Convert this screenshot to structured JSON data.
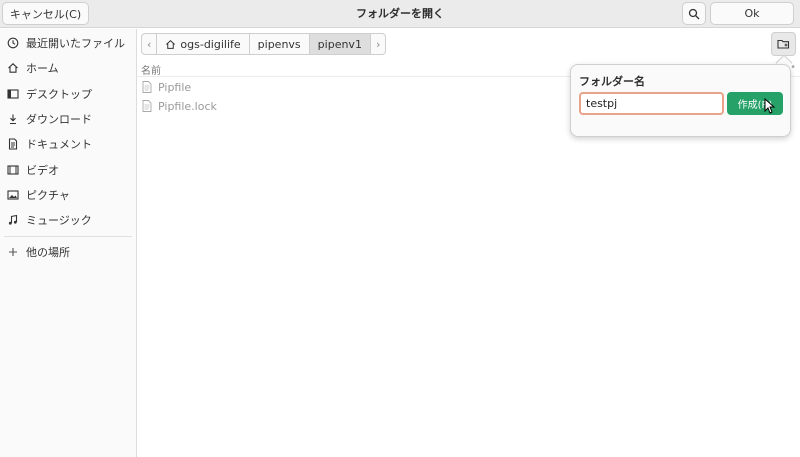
{
  "header": {
    "cancel_label": "キャンセル(C)",
    "title": "フォルダーを開く",
    "ok_label": "Ok"
  },
  "sidebar": {
    "items": [
      {
        "label": "最近開いたファイル",
        "icon": "clock-icon"
      },
      {
        "label": "ホーム",
        "icon": "home-icon"
      },
      {
        "label": "デスクトップ",
        "icon": "desktop-icon"
      },
      {
        "label": "ダウンロード",
        "icon": "download-icon"
      },
      {
        "label": "ドキュメント",
        "icon": "document-icon"
      },
      {
        "label": "ビデオ",
        "icon": "video-icon"
      },
      {
        "label": "ピクチャ",
        "icon": "picture-icon"
      },
      {
        "label": "ミュージック",
        "icon": "music-icon"
      }
    ],
    "other_places": {
      "label": "他の場所",
      "icon": "plus-icon"
    }
  },
  "pathbar": {
    "segments": [
      "ogs-digilife",
      "pipenvs",
      "pipenv1"
    ],
    "active_index": 2
  },
  "filelist": {
    "column_name": "名前",
    "files": [
      {
        "name": "Pipfile",
        "icon": "text-file-icon"
      },
      {
        "name": "Pipfile.lock",
        "icon": "text-file-icon"
      }
    ]
  },
  "new_folder_popover": {
    "title": "フォルダー名",
    "input_value": "testpj",
    "create_label": "作成(R)"
  },
  "colors": {
    "accent_green": "#26a269",
    "input_focus_border": "#e8a48a",
    "header_bg": "#ebebeb"
  }
}
